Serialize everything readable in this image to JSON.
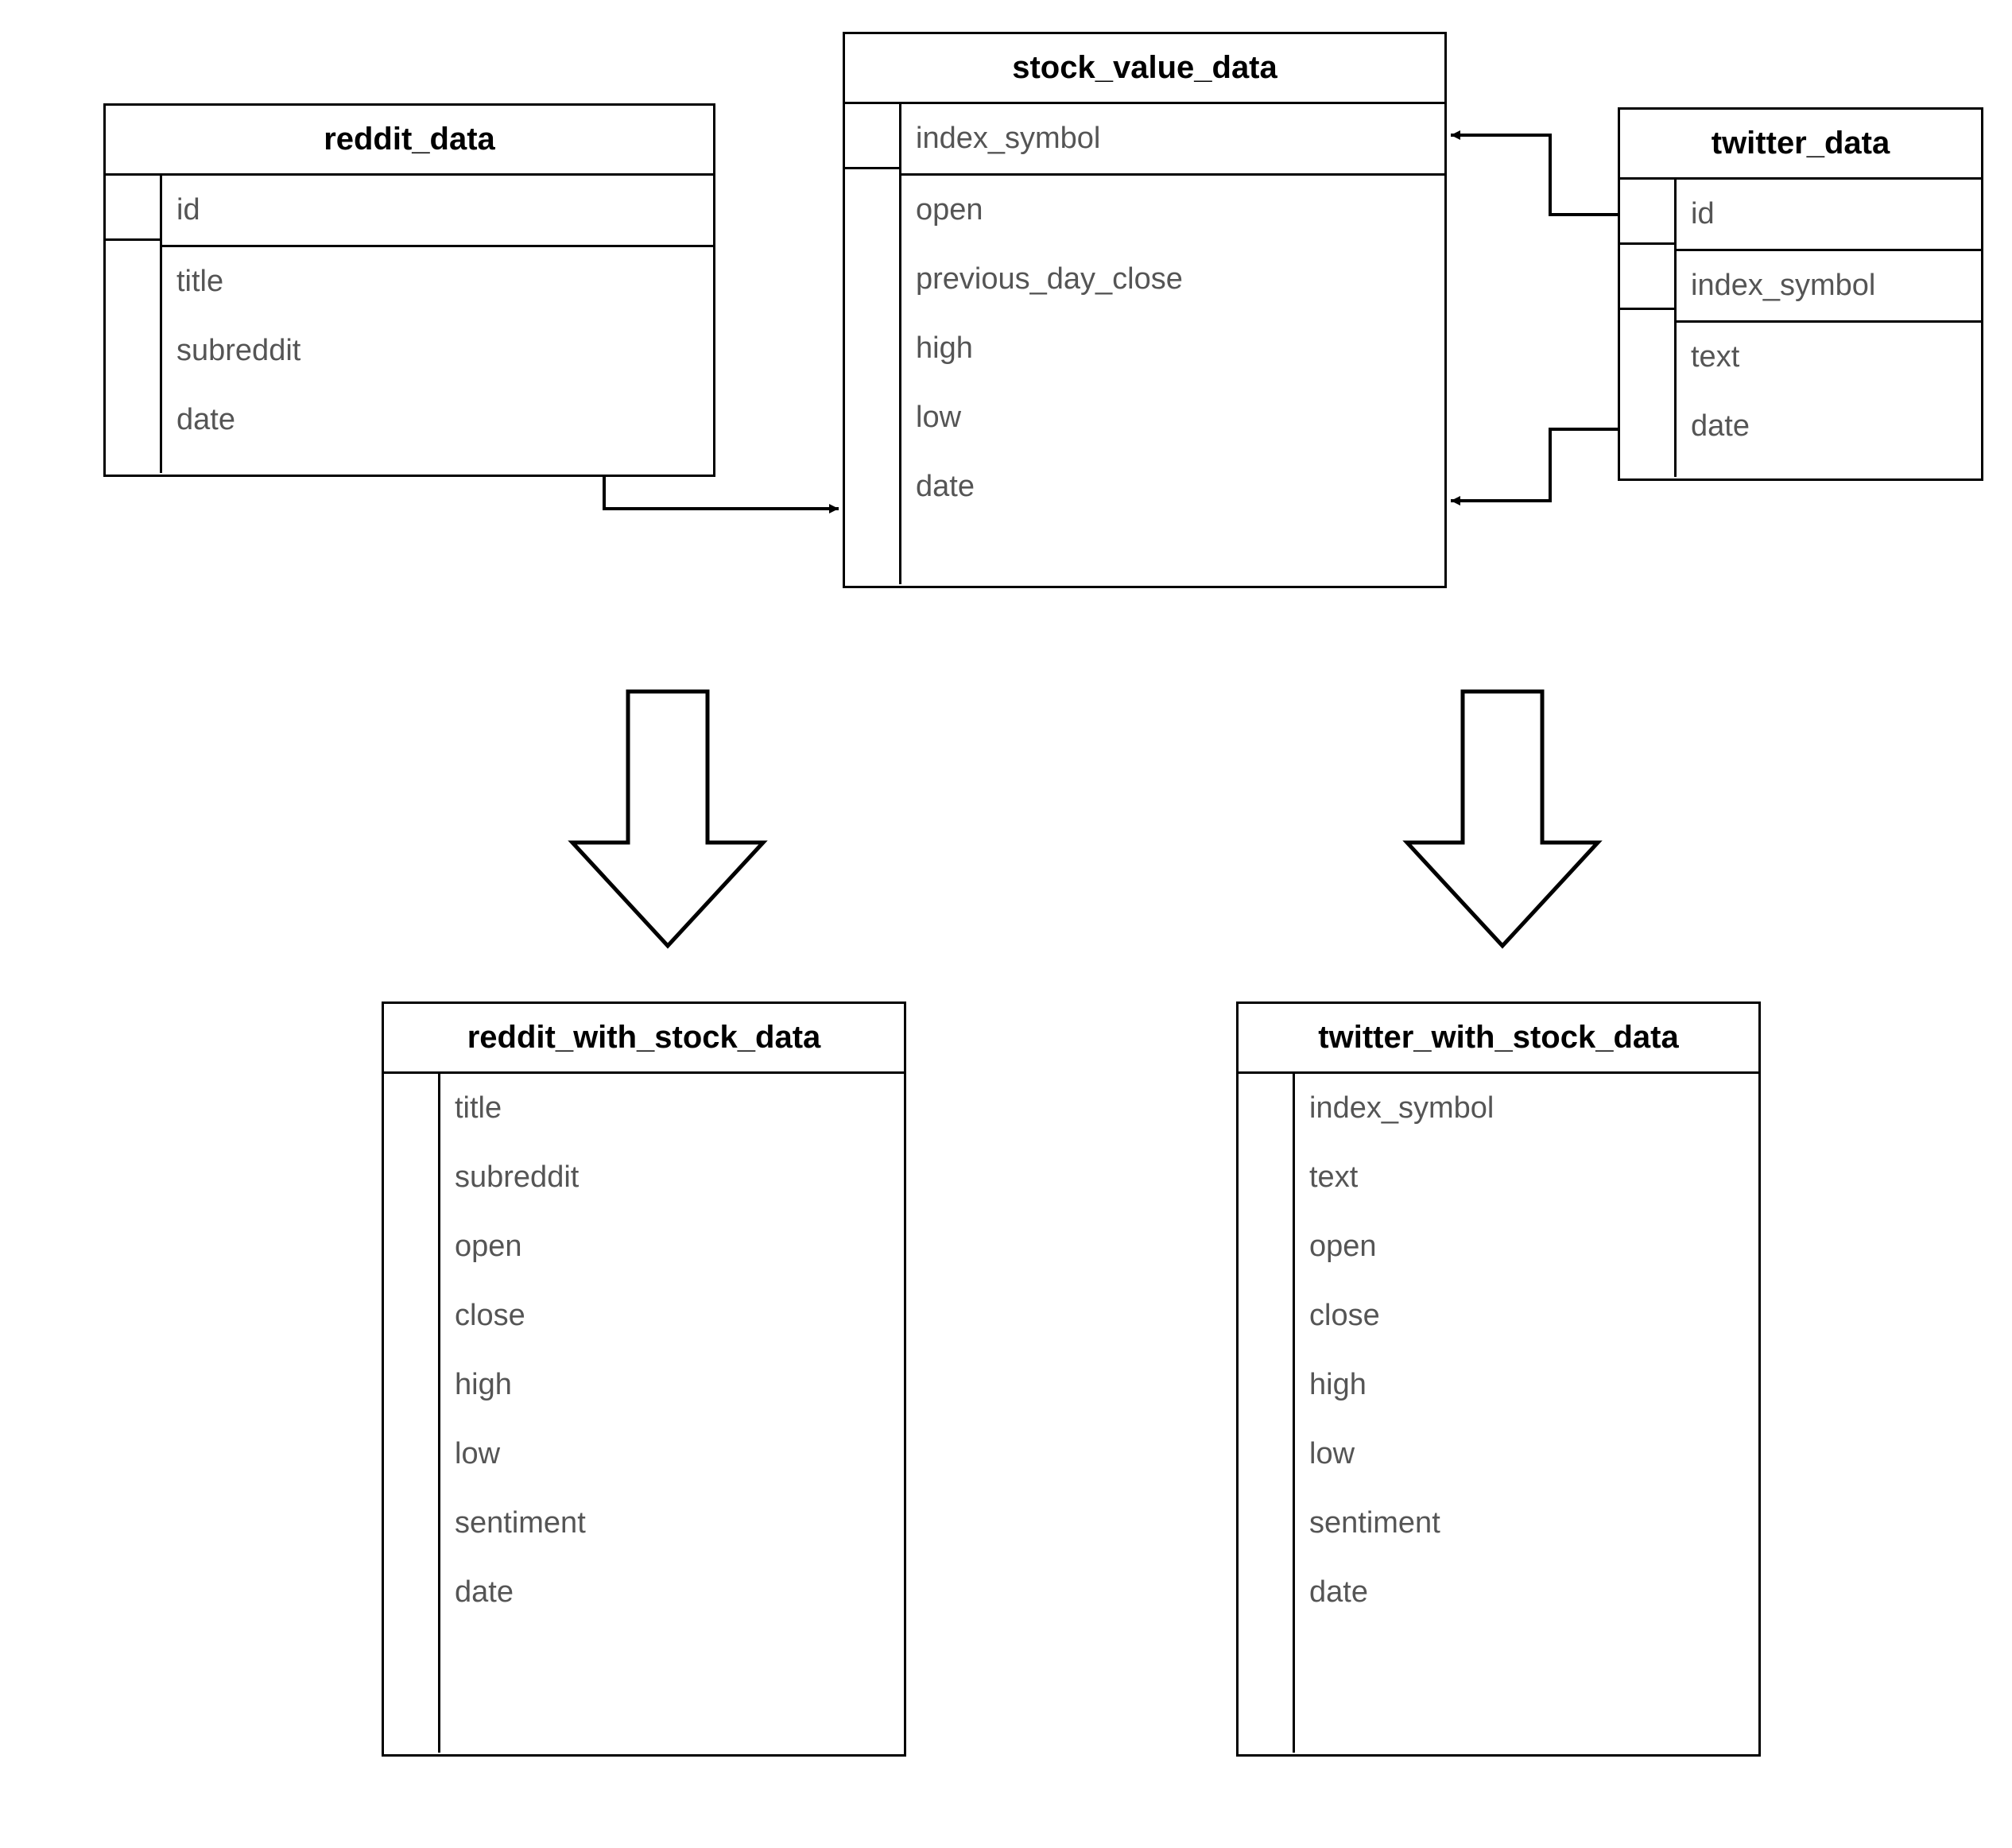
{
  "entities": {
    "reddit_data": {
      "title": "reddit_data",
      "fields": [
        "id",
        "title",
        "subreddit",
        "date"
      ],
      "key_rows": 1
    },
    "stock_value_data": {
      "title": "stock_value_data",
      "fields": [
        "index_symbol",
        "open",
        "previous_day_close",
        "high",
        "low",
        "date"
      ],
      "key_rows": 1
    },
    "twitter_data": {
      "title": "twitter_data",
      "fields": [
        "id",
        "index_symbol",
        "text",
        "date"
      ],
      "key_rows": 2
    },
    "reddit_with_stock_data": {
      "title": "reddit_with_stock_data",
      "fields": [
        "title",
        "subreddit",
        "open",
        "close",
        "high",
        "low",
        "sentiment",
        "date"
      ],
      "key_rows": 0
    },
    "twitter_with_stock_data": {
      "title": "twitter_with_stock_data",
      "fields": [
        "index_symbol",
        "text",
        "open",
        "close",
        "high",
        "low",
        "sentiment",
        "date"
      ],
      "key_rows": 0
    }
  }
}
